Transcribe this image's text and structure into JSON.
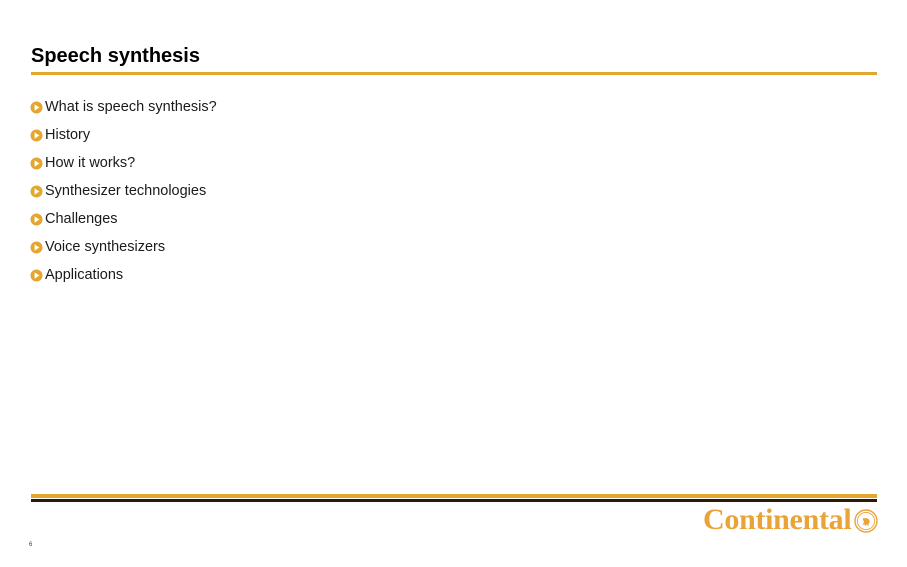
{
  "slide": {
    "title": "Speech synthesis",
    "page_number": "6",
    "accent_color": "#E3A72F",
    "dark_rule_color": "#2b1a06",
    "bullets": [
      {
        "label": "What is speech synthesis?",
        "marker": "play-circle-icon"
      },
      {
        "label": "History",
        "marker": "play-circle-icon"
      },
      {
        "label": "How it works?",
        "marker": "play-circle-icon"
      },
      {
        "label": "Synthesizer technologies",
        "marker": "play-circle-icon"
      },
      {
        "label": "Challenges",
        "marker": "play-circle-icon"
      },
      {
        "label": "Voice synthesizers",
        "marker": "play-circle-icon"
      },
      {
        "label": "Applications",
        "marker": "play-circle-icon"
      }
    ]
  },
  "logo": {
    "wordmark": "Continental",
    "emblem": "continental-horse-emblem-icon",
    "color": "#E9A336"
  }
}
